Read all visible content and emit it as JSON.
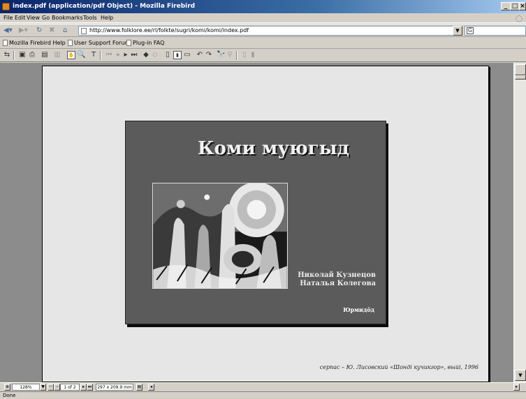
{
  "window": {
    "title": "index.pdf (application/pdf Object) - Mozilla Firebird",
    "min": "_",
    "max": "□",
    "close": "×"
  },
  "menu": [
    "File",
    "Edit",
    "View",
    "Go",
    "Bookmarks",
    "Tools",
    "Help"
  ],
  "nav": {
    "url": "http://www.folklore.ee/rl/folkte/sugri/komi/komi/index.pdf",
    "search_placeholder": "G"
  },
  "bookmarks": [
    "Mozilla Firebird Help",
    "User Support Forum",
    "Plug-in FAQ"
  ],
  "pdf": {
    "cover_title": "Коми муюгыд",
    "authors": [
      "Николай  Кузнецов",
      "Наталья  Колегова"
    ],
    "publisher": "Юрмидӧд",
    "caption": "серпас – Ю. Лисовский «Шонді кучикгор», выйі, 1996"
  },
  "acro_status": {
    "zoom": "128%",
    "page": "1 of 2",
    "size": "297 x 209.9 mm"
  },
  "status": "Done",
  "colors": {
    "titlebar": "#0a246a",
    "cover_bg": "#5b5b5b",
    "page_bg": "#e6e6e6",
    "viewer_bg": "#8c8c8c"
  }
}
